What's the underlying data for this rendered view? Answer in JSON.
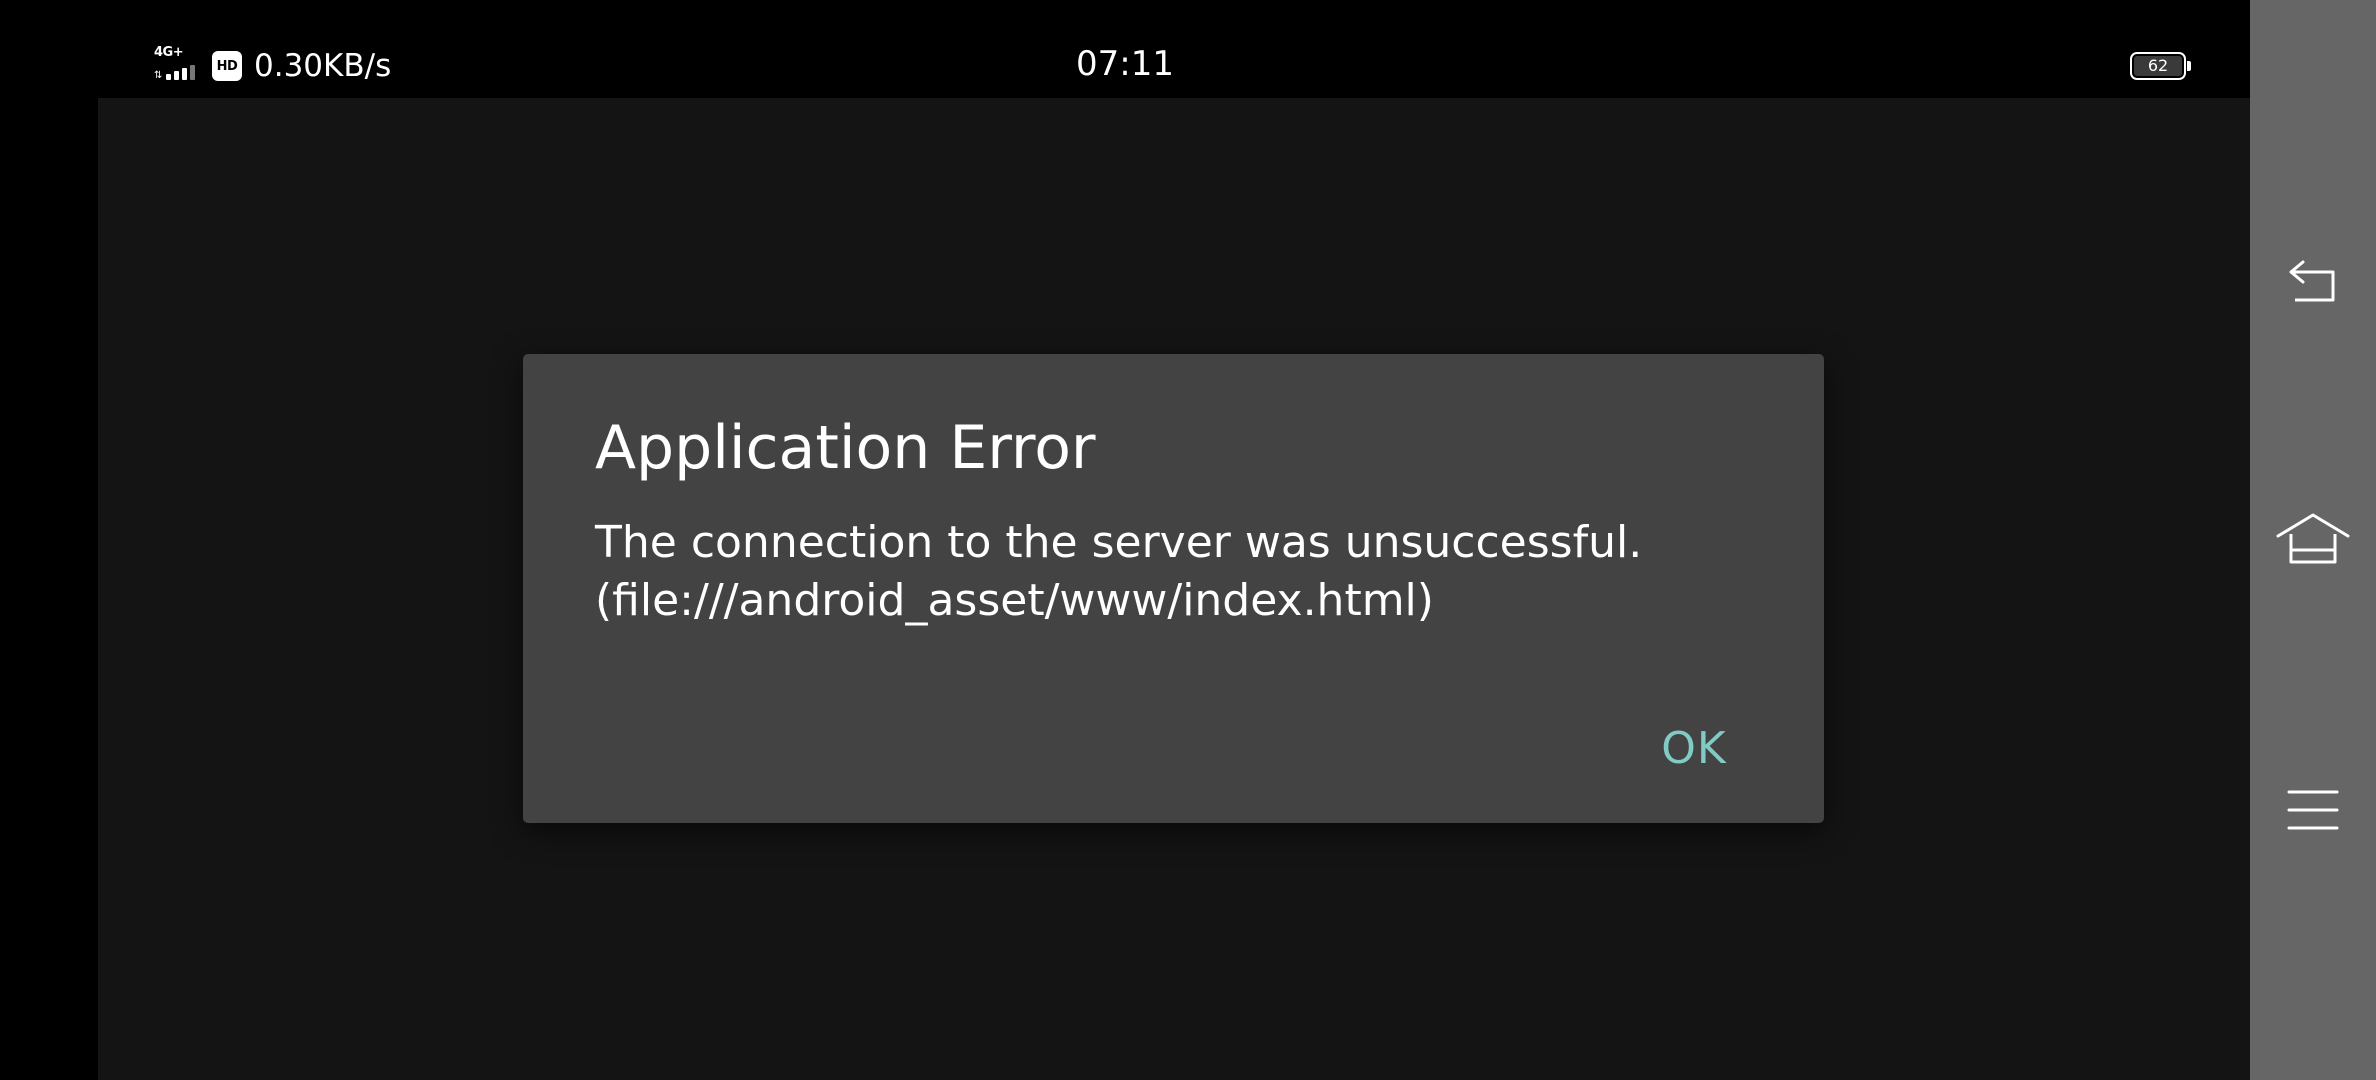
{
  "status_bar": {
    "network_type": "4G+",
    "hd_badge": "HD",
    "net_speed": "0.30KB/s",
    "time": "07:11",
    "battery_level": "62",
    "signal_icon": "signal-bars-icon",
    "battery_icon": "battery-icon"
  },
  "dialog": {
    "title": "Application Error",
    "message_line1": "The connection to the server was unsuccessful.",
    "message_line2": "(file:///android_asset/www/index.html)",
    "ok_label": "OK"
  },
  "nav_bar": {
    "buttons": [
      {
        "name": "back",
        "icon": "back-icon"
      },
      {
        "name": "home",
        "icon": "home-icon"
      },
      {
        "name": "recents",
        "icon": "menu-icon"
      }
    ]
  },
  "colors": {
    "background": "#000000",
    "app_background": "#141414",
    "dialog_background": "#434343",
    "accent": "#80cbc4",
    "nav_bar": "#666666",
    "text": "#ffffff"
  }
}
